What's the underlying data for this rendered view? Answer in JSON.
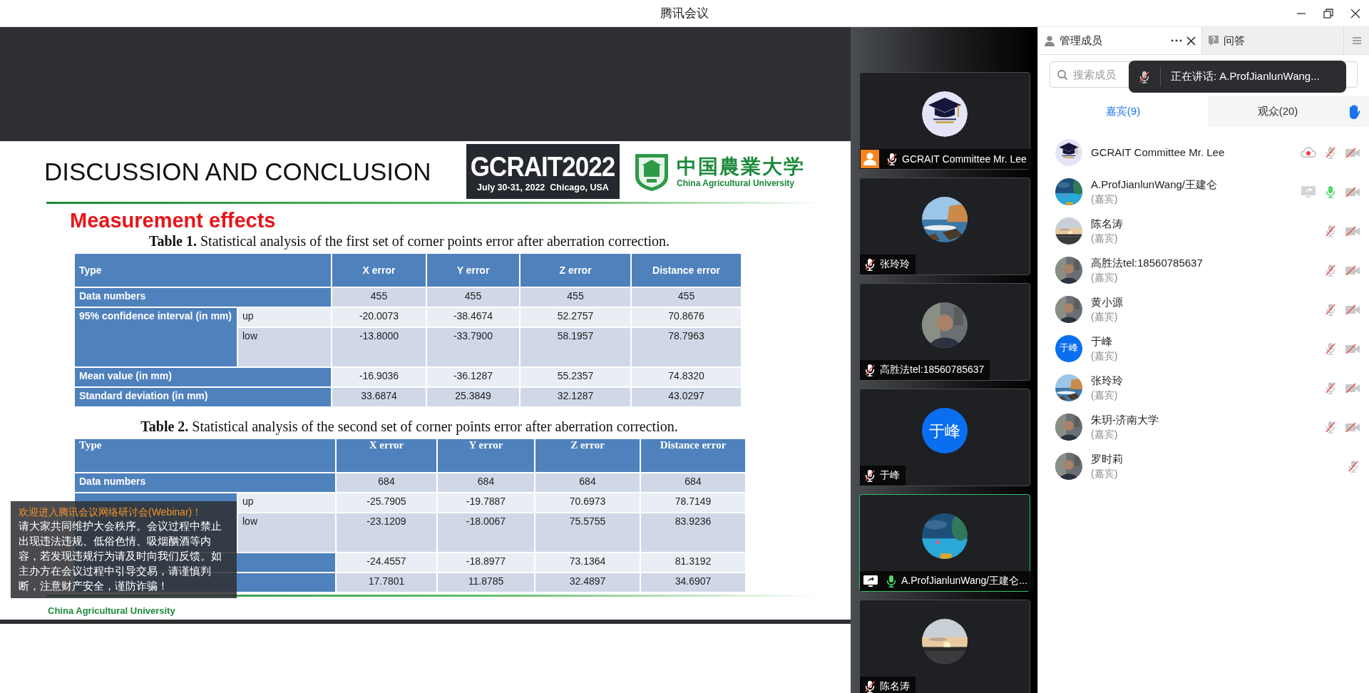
{
  "window": {
    "title": "腾讯会议"
  },
  "slide": {
    "title": "DISCUSSION AND CONCLUSION",
    "event_logo": {
      "name": "GCRAIT2022",
      "dates": "July 30-31, 2022  Chicago, USA"
    },
    "university_logo": {
      "chinese": "中国農業大学",
      "english": "China Agricultural University"
    },
    "heading": "Measurement effects",
    "tables": [
      {
        "caption": "**Table 1.** Statistical analysis of the first set of corner points error after aberration correction.",
        "columns": [
          "Type",
          "X error",
          "Y error",
          "Z error",
          "Distance error"
        ],
        "rows": [
          {
            "kind": "single",
            "label": "Data numbers",
            "values": [
              "455",
              "455",
              "455",
              "455"
            ]
          },
          {
            "kind": "group_first",
            "label": "95% confidence interval (in mm)",
            "sub": "up",
            "values": [
              "-20.0073",
              "-38.4674",
              "52.2757",
              "70.8676"
            ]
          },
          {
            "kind": "group_next",
            "sub": "low",
            "values": [
              "-13.8000",
              "-33.7900",
              "58.1957",
              "78.7963"
            ]
          },
          {
            "kind": "single",
            "label": "Mean value (in mm)",
            "values": [
              "-16.9036",
              "-36.1287",
              "55.2357",
              "74.8320"
            ]
          },
          {
            "kind": "single",
            "label": "Standard deviation (in mm)",
            "values": [
              "33.6874",
              "25.3849",
              "32.1287",
              "43.0297"
            ]
          }
        ]
      },
      {
        "caption": "**Table 2.** Statistical analysis of the second set of corner points error after aberration correction.",
        "columns": [
          "Type",
          "X error",
          "Y error",
          "Z error",
          "Distance error"
        ],
        "rows": [
          {
            "kind": "single",
            "label": "Data numbers",
            "values": [
              "684",
              "684",
              "684",
              "684"
            ]
          },
          {
            "kind": "group_first",
            "sub": "up",
            "values": [
              "-25.7905",
              "-19.7887",
              "70.6973",
              "78.7149"
            ]
          },
          {
            "kind": "group_next",
            "sub": "low",
            "values": [
              "-23.1209",
              "-18.0067",
              "75.5755",
              "83.9236"
            ]
          },
          {
            "kind": "single",
            "values": [
              "-24.4557",
              "-18.8977",
              "73.1364",
              "81.3192"
            ]
          },
          {
            "kind": "single",
            "values": [
              "17.7801",
              "11.8785",
              "32.4897",
              "34.6907"
            ]
          }
        ]
      }
    ],
    "footer": "China Agricultural University"
  },
  "notice": {
    "title": "欢迎进入腾讯会议网络研讨会(Webinar)！",
    "text": "请大家共同维护大会秩序。会议过程中禁止出现违法违规、低俗色情、吸烟酗酒等内容，若发现违规行为请及时向我们反馈。如主办方在会议过程中引导交易，请谨慎判断，注意财产安全，谨防诈骗！"
  },
  "video_tiles": [
    {
      "name": "GCRAIT Committee Mr. Lee",
      "avatar": {
        "kind": "logo"
      },
      "host": true,
      "sharing": false,
      "mic_on": false,
      "speaking": false
    },
    {
      "name": "张玲玲",
      "host": false,
      "sharing": false,
      "mic_on": false,
      "speaking": false
    },
    {
      "name": "高胜法tel:18560785637",
      "host": false,
      "sharing": false,
      "mic_on": false,
      "speaking": false
    },
    {
      "name": "于峰",
      "avatar": {
        "kind": "initials",
        "text": "于峰"
      },
      "host": false,
      "sharing": false,
      "mic_on": false,
      "speaking": false
    },
    {
      "name": "A.ProfJianlunWang/王建仑...",
      "host": false,
      "sharing": true,
      "mic_on": true,
      "speaking": true
    },
    {
      "name": "陈名涛",
      "host": false,
      "sharing": false,
      "mic_on": false,
      "speaking": false
    }
  ],
  "panel": {
    "tabs": [
      {
        "label": "管理成员",
        "selected": true
      },
      {
        "label": "问答",
        "selected": false
      }
    ],
    "search": {
      "placeholder": "搜索成员"
    },
    "speaking_toast": {
      "text": "正在讲话: A.ProfJianlunWang..."
    },
    "member_tabs": [
      {
        "label": "嘉宾(9)",
        "selected": true
      },
      {
        "label": "观众(20)",
        "selected": false
      }
    ],
    "members": [
      {
        "name": "GCRAIT Committee Mr. Lee",
        "avatar": {
          "kind": "logo"
        },
        "recording": true,
        "sharing": false,
        "mic_on": false,
        "camera_off": true
      },
      {
        "name": "A.ProfJianlunWang/王建仑",
        "role": "(嘉宾)",
        "recording": false,
        "sharing": true,
        "mic_on": true,
        "camera_off": true
      },
      {
        "name": "陈名涛",
        "role": "(嘉宾)",
        "recording": false,
        "sharing": false,
        "mic_on": false,
        "camera_off": true
      },
      {
        "name": "高胜法tel:18560785637",
        "role": "(嘉宾)",
        "recording": false,
        "sharing": false,
        "mic_on": false,
        "camera_off": true
      },
      {
        "name": "黄小源",
        "role": "(嘉宾)",
        "recording": false,
        "sharing": false,
        "mic_on": false,
        "camera_off": true
      },
      {
        "name": "于峰",
        "role": "(嘉宾)",
        "avatar": {
          "kind": "initials",
          "text": "于峰"
        },
        "recording": false,
        "sharing": false,
        "mic_on": false,
        "camera_off": true
      },
      {
        "name": "张玲玲",
        "role": "(嘉宾)",
        "recording": false,
        "sharing": false,
        "mic_on": false,
        "camera_off": true
      },
      {
        "name": "朱玥-济南大学",
        "role": "(嘉宾)",
        "recording": false,
        "sharing": false,
        "mic_on": false,
        "camera_off": true
      },
      {
        "name": "罗时莉",
        "role": "(嘉宾)",
        "recording": false,
        "sharing": false,
        "mic_on": false,
        "camera_off": false
      }
    ]
  }
}
